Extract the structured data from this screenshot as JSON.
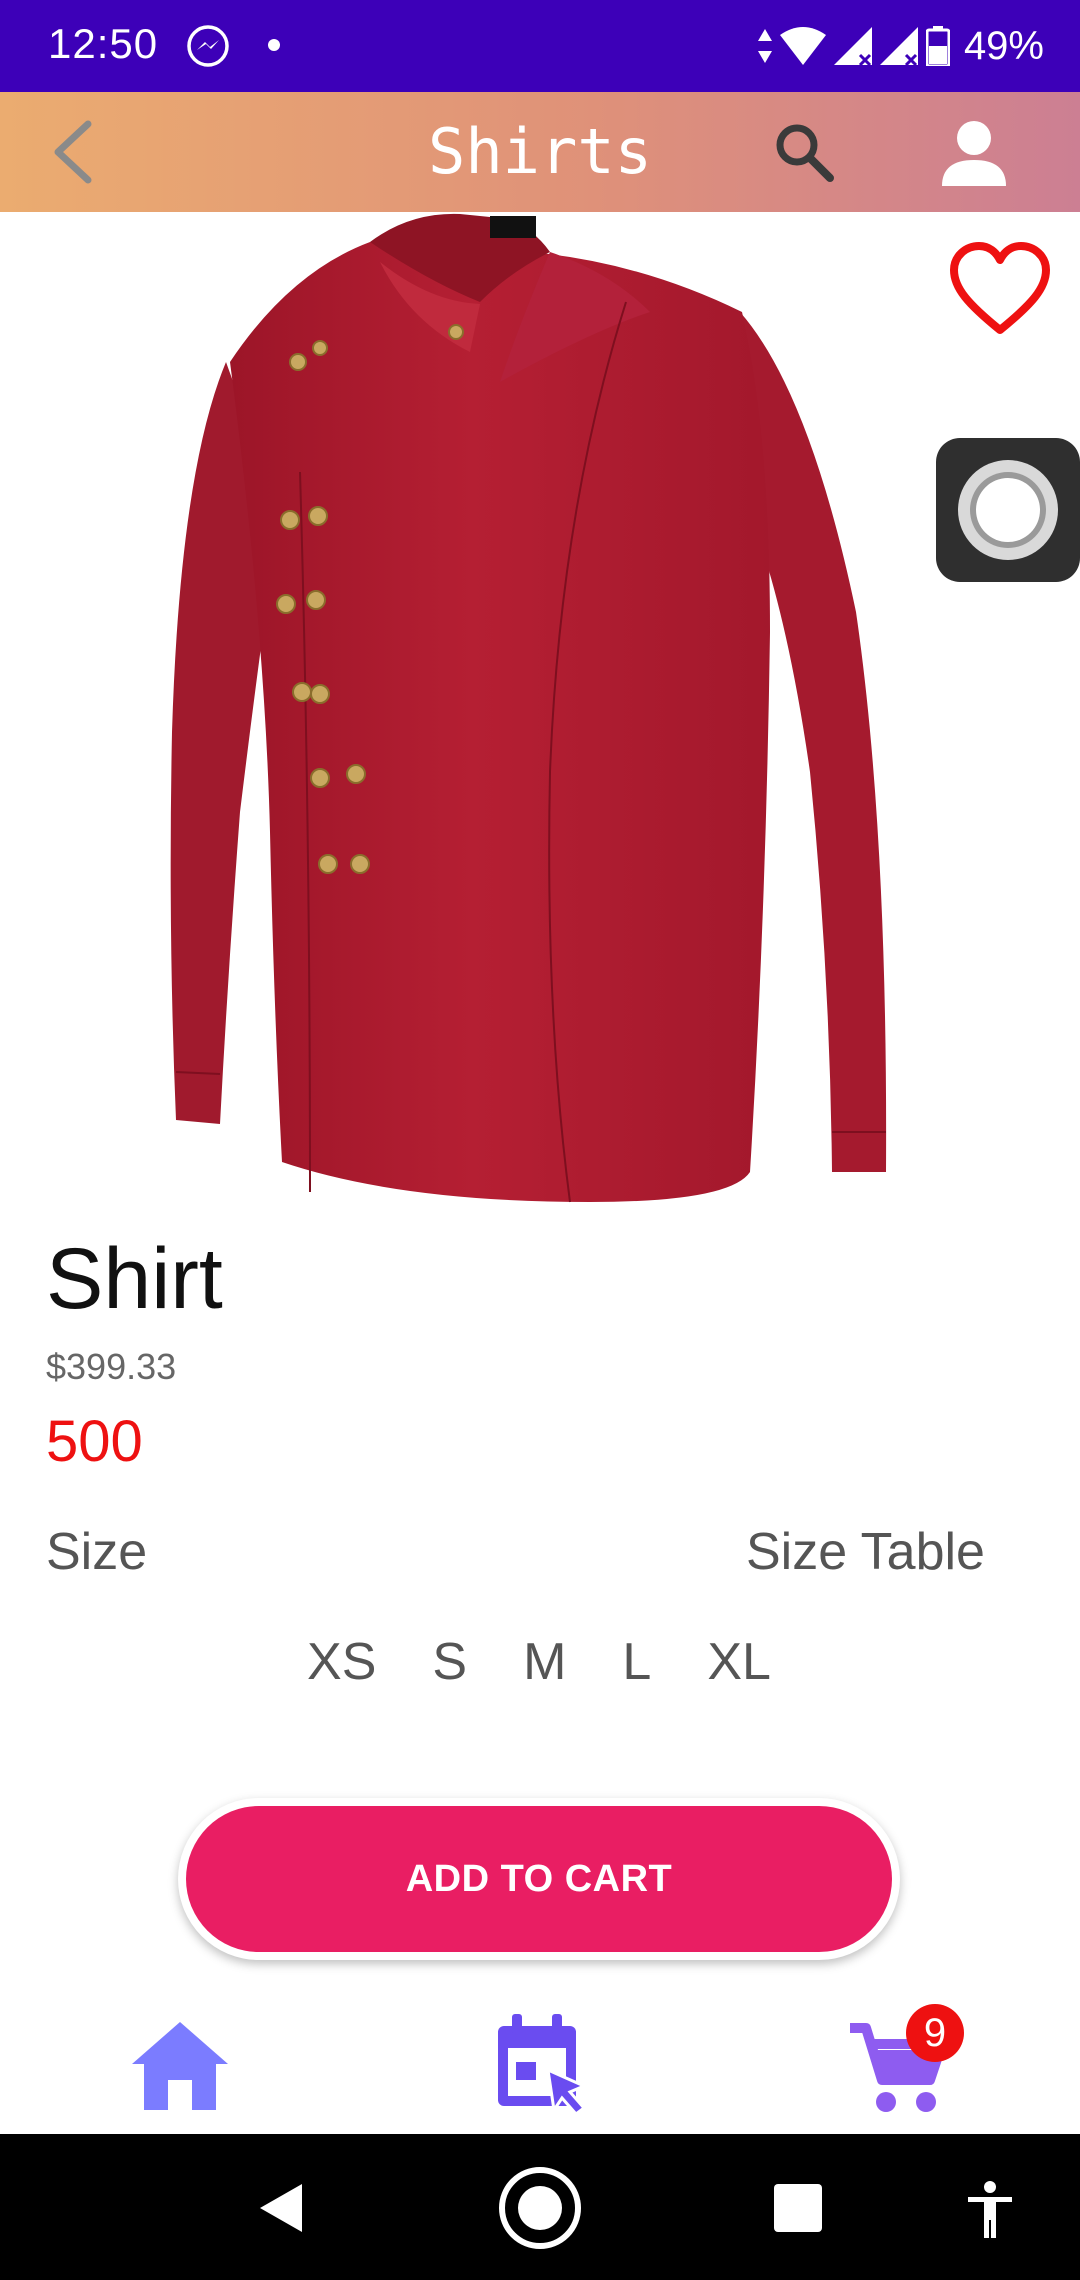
{
  "status_bar": {
    "time": "12:50",
    "battery": "49%",
    "notification_icons": [
      "messenger-icon",
      "dot-icon"
    ],
    "system_icons": [
      "wifi-icon",
      "signal-icon",
      "signal-icon",
      "battery-icon"
    ]
  },
  "app_bar": {
    "title": "Shirts",
    "back_icon": "chevron-left-icon",
    "search_icon": "search-icon",
    "user_icon": "person-icon"
  },
  "product": {
    "image_alt": "red double-breasted shirt",
    "name": "Shirt",
    "old_price": "$399.33",
    "price": "500",
    "favorite_icon": "heart-outline-icon"
  },
  "size_section": {
    "label": "Size",
    "table_link": "Size Table",
    "options": [
      "XS",
      "S",
      "M",
      "L",
      "XL"
    ]
  },
  "actions": {
    "add_to_cart": "ADD TO CART"
  },
  "bottom_nav": {
    "items": [
      "home-icon",
      "calendar-icon",
      "cart-icon"
    ],
    "cart_badge": "9"
  },
  "colors": {
    "status_bar": "#3d00b8",
    "accent": "#e91e63",
    "price": "#ee1111",
    "nav_icon": "#7b7cff"
  }
}
